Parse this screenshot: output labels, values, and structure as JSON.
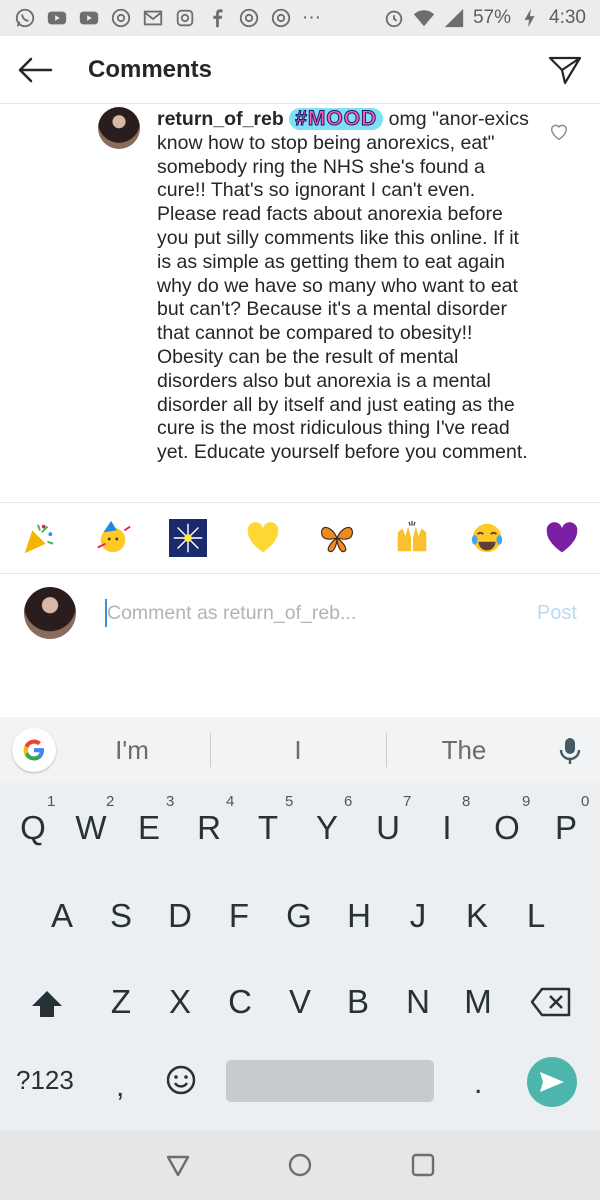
{
  "status_bar": {
    "battery_percent": "57%",
    "time": "4:30",
    "more": "···",
    "left_icons": [
      "whatsapp-icon",
      "youtube-icon",
      "youtube-icon",
      "chrome-icon",
      "gmail-icon",
      "instagram-icon",
      "facebook-icon",
      "chrome-icon",
      "chrome-icon"
    ],
    "right_icons": [
      "alarm-icon",
      "wifi-icon",
      "signal-icon",
      "charging-icon"
    ]
  },
  "header": {
    "title": "Comments",
    "back_icon": "arrow-left-icon",
    "share_icon": "paper-plane-icon"
  },
  "comment": {
    "username": "return_of_reb",
    "badge": "#MOOD",
    "text": "omg \"anor-exics know how to stop being anorexics, eat\" somebody ring the NHS she's found a cure!! That's so ignorant I can't even. Please read facts about anorexia before you put silly comments like this online. If it is as simple as getting them to eat again why do we have so many who want to eat but can't? Because it's a mental disorder that cannot be compared to obesity!! Obesity can be the result of mental disorders also but anorexia is a mental disorder all by itself and just eating as the cure is the most ridiculous thing I've read yet. Educate yourself before you comment."
  },
  "emoji_bar": [
    "party-popper",
    "party-face",
    "sparkler",
    "yellow-heart",
    "butterfly",
    "raising-hands",
    "tears-of-joy",
    "purple-heart"
  ],
  "composer": {
    "placeholder": "Comment as return_of_reb...",
    "value": "",
    "post_label": "Post"
  },
  "keyboard": {
    "suggestions": [
      "I'm",
      "I",
      "The"
    ],
    "row1": [
      "Q",
      "W",
      "E",
      "R",
      "T",
      "Y",
      "U",
      "I",
      "O",
      "P"
    ],
    "row1_nums": [
      "1",
      "2",
      "3",
      "4",
      "5",
      "6",
      "7",
      "8",
      "9",
      "0"
    ],
    "row2": [
      "A",
      "S",
      "D",
      "F",
      "G",
      "H",
      "J",
      "K",
      "L"
    ],
    "row3": [
      "Z",
      "X",
      "C",
      "V",
      "B",
      "N",
      "M"
    ],
    "symbols_label": "?123",
    "comma": ",",
    "period": "."
  },
  "colors": {
    "accent": "#3897f0",
    "post_disabled": "#b8dcf5",
    "enter": "#4db6ac",
    "mood_fill": "#ff5fb0"
  }
}
